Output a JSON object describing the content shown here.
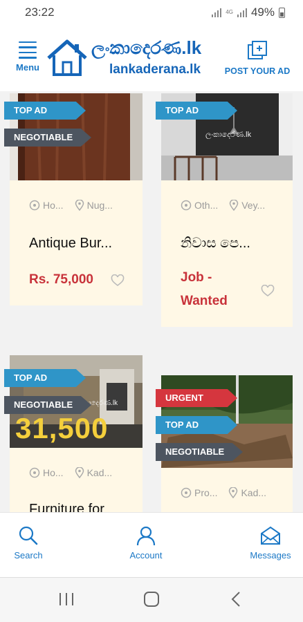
{
  "status_bar": {
    "time": "23:22",
    "network": "4G",
    "battery": "49%"
  },
  "header": {
    "menu_label": "Menu",
    "logo_sinhala": "ලංකාදෙරණ.lk",
    "logo_english": "lankaderana.lk",
    "post_label": "POST YOUR AD"
  },
  "listings": [
    {
      "tags": [
        "TOP AD",
        "NEGOTIABLE"
      ],
      "category": "Ho...",
      "location": "Nug...",
      "title": "Antique Bur...",
      "price": "Rs. 75,000"
    },
    {
      "tags": [
        "TOP AD"
      ],
      "watermark": "ලංකාදෙරණ.lk",
      "category": "Oth...",
      "location": "Vey...",
      "title": "නිවාස පෙ...",
      "price_line1": "Job -",
      "price_line2": "Wanted"
    },
    {
      "tags": [
        "TOP AD",
        "NEGOTIABLE"
      ],
      "image_price": "31,500",
      "watermark": "ලංකාදෙරණ.lk",
      "category": "Ho...",
      "location": "Kad...",
      "title": "Furniture for"
    },
    {
      "tags": [
        "URGENT",
        "TOP AD",
        "NEGOTIABLE"
      ],
      "category": "Pro...",
      "location": "Kad..."
    }
  ],
  "bottom_nav": {
    "search": "Search",
    "account": "Account",
    "messages": "Messages"
  },
  "colors": {
    "brand": "#1b78c6",
    "top_ad": "#2f95c8",
    "negotiable": "#4d5560",
    "urgent": "#d5363e",
    "price": "#c8323a",
    "card_bg": "#fff8e6"
  },
  "icons": [
    "menu-icon",
    "house-logo-icon",
    "post-ad-icon",
    "category-icon",
    "location-pin-icon",
    "heart-icon",
    "search-icon",
    "account-icon",
    "messages-icon",
    "recent-apps-icon",
    "home-icon",
    "back-icon"
  ]
}
